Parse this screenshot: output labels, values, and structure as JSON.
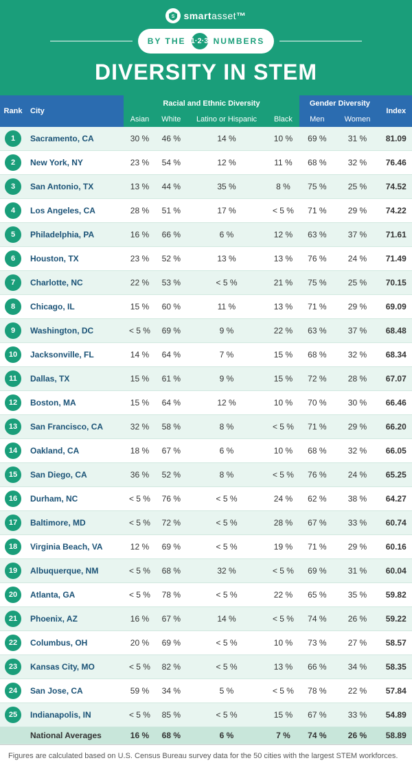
{
  "header": {
    "logo": "smartasset",
    "logo_icon": "shield",
    "badge_text": "BY THE",
    "badge_numbers": "1·2·3",
    "badge_suffix": "NUMBERS",
    "title": "DIVERSITY IN STEM"
  },
  "table": {
    "col_group1": "Racial and Ethnic Diversity",
    "col_group2": "Gender Diversity",
    "col_index": "Index",
    "col_rank": "Rank",
    "col_city": "City",
    "subheaders": [
      "Asian",
      "White",
      "Latino or Hispanic",
      "Black",
      "Men",
      "Women"
    ],
    "rows": [
      {
        "rank": 1,
        "city": "Sacramento, CA",
        "asian": "30 %",
        "white": "46 %",
        "latino": "14 %",
        "black": "10 %",
        "men": "69 %",
        "women": "31 %",
        "index": "81.09"
      },
      {
        "rank": 2,
        "city": "New York, NY",
        "asian": "23 %",
        "white": "54 %",
        "latino": "12 %",
        "black": "11 %",
        "men": "68 %",
        "women": "32 %",
        "index": "76.46"
      },
      {
        "rank": 3,
        "city": "San Antonio, TX",
        "asian": "13 %",
        "white": "44 %",
        "latino": "35 %",
        "black": "8 %",
        "men": "75 %",
        "women": "25 %",
        "index": "74.52"
      },
      {
        "rank": 4,
        "city": "Los Angeles, CA",
        "asian": "28 %",
        "white": "51 %",
        "latino": "17 %",
        "black": "< 5 %",
        "men": "71 %",
        "women": "29 %",
        "index": "74.22"
      },
      {
        "rank": 5,
        "city": "Philadelphia, PA",
        "asian": "16 %",
        "white": "66 %",
        "latino": "6 %",
        "black": "12 %",
        "men": "63 %",
        "women": "37 %",
        "index": "71.61"
      },
      {
        "rank": 6,
        "city": "Houston, TX",
        "asian": "23 %",
        "white": "52 %",
        "latino": "13 %",
        "black": "13 %",
        "men": "76 %",
        "women": "24 %",
        "index": "71.49"
      },
      {
        "rank": 7,
        "city": "Charlotte, NC",
        "asian": "22 %",
        "white": "53 %",
        "latino": "< 5 %",
        "black": "21 %",
        "men": "75 %",
        "women": "25 %",
        "index": "70.15"
      },
      {
        "rank": 8,
        "city": "Chicago, IL",
        "asian": "15 %",
        "white": "60 %",
        "latino": "11 %",
        "black": "13 %",
        "men": "71 %",
        "women": "29 %",
        "index": "69.09"
      },
      {
        "rank": 9,
        "city": "Washington, DC",
        "asian": "< 5 %",
        "white": "69 %",
        "latino": "9 %",
        "black": "22 %",
        "men": "63 %",
        "women": "37 %",
        "index": "68.48"
      },
      {
        "rank": 10,
        "city": "Jacksonville, FL",
        "asian": "14 %",
        "white": "64 %",
        "latino": "7 %",
        "black": "15 %",
        "men": "68 %",
        "women": "32 %",
        "index": "68.34"
      },
      {
        "rank": 11,
        "city": "Dallas, TX",
        "asian": "15 %",
        "white": "61 %",
        "latino": "9 %",
        "black": "15 %",
        "men": "72 %",
        "women": "28 %",
        "index": "67.07"
      },
      {
        "rank": 12,
        "city": "Boston, MA",
        "asian": "15 %",
        "white": "64 %",
        "latino": "12 %",
        "black": "10 %",
        "men": "70 %",
        "women": "30 %",
        "index": "66.46"
      },
      {
        "rank": 13,
        "city": "San Francisco, CA",
        "asian": "32 %",
        "white": "58 %",
        "latino": "8 %",
        "black": "< 5 %",
        "men": "71 %",
        "women": "29 %",
        "index": "66.20"
      },
      {
        "rank": 14,
        "city": "Oakland, CA",
        "asian": "18 %",
        "white": "67 %",
        "latino": "6 %",
        "black": "10 %",
        "men": "68 %",
        "women": "32 %",
        "index": "66.05"
      },
      {
        "rank": 15,
        "city": "San Diego, CA",
        "asian": "36 %",
        "white": "52 %",
        "latino": "8 %",
        "black": "< 5 %",
        "men": "76 %",
        "women": "24 %",
        "index": "65.25"
      },
      {
        "rank": 16,
        "city": "Durham, NC",
        "asian": "< 5 %",
        "white": "76 %",
        "latino": "< 5 %",
        "black": "24 %",
        "men": "62 %",
        "women": "38 %",
        "index": "64.27"
      },
      {
        "rank": 17,
        "city": "Baltimore, MD",
        "asian": "< 5 %",
        "white": "72 %",
        "latino": "< 5 %",
        "black": "28 %",
        "men": "67 %",
        "women": "33 %",
        "index": "60.74"
      },
      {
        "rank": 18,
        "city": "Virginia Beach, VA",
        "asian": "12 %",
        "white": "69 %",
        "latino": "< 5 %",
        "black": "19 %",
        "men": "71 %",
        "women": "29 %",
        "index": "60.16"
      },
      {
        "rank": 19,
        "city": "Albuquerque, NM",
        "asian": "< 5 %",
        "white": "68 %",
        "latino": "32 %",
        "black": "< 5 %",
        "men": "69 %",
        "women": "31 %",
        "index": "60.04"
      },
      {
        "rank": 20,
        "city": "Atlanta, GA",
        "asian": "< 5 %",
        "white": "78 %",
        "latino": "< 5 %",
        "black": "22 %",
        "men": "65 %",
        "women": "35 %",
        "index": "59.82"
      },
      {
        "rank": 21,
        "city": "Phoenix, AZ",
        "asian": "16 %",
        "white": "67 %",
        "latino": "14 %",
        "black": "< 5 %",
        "men": "74 %",
        "women": "26 %",
        "index": "59.22"
      },
      {
        "rank": 22,
        "city": "Columbus, OH",
        "asian": "20 %",
        "white": "69 %",
        "latino": "< 5 %",
        "black": "10 %",
        "men": "73 %",
        "women": "27 %",
        "index": "58.57"
      },
      {
        "rank": 23,
        "city": "Kansas City, MO",
        "asian": "< 5 %",
        "white": "82 %",
        "latino": "< 5 %",
        "black": "13 %",
        "men": "66 %",
        "women": "34 %",
        "index": "58.35"
      },
      {
        "rank": 24,
        "city": "San Jose, CA",
        "asian": "59 %",
        "white": "34 %",
        "latino": "5 %",
        "black": "< 5 %",
        "men": "78 %",
        "women": "22 %",
        "index": "57.84"
      },
      {
        "rank": 25,
        "city": "Indianapolis, IN",
        "asian": "< 5 %",
        "white": "85 %",
        "latino": "< 5 %",
        "black": "15 %",
        "men": "67 %",
        "women": "33 %",
        "index": "54.89"
      },
      {
        "rank": null,
        "city": "National Averages",
        "asian": "16 %",
        "white": "68 %",
        "latino": "6 %",
        "black": "7 %",
        "men": "74 %",
        "women": "26 %",
        "index": "58.89"
      }
    ]
  },
  "footer": "Figures are calculated based on U.S. Census Bureau survey data for the 50 cities with the largest STEM workforces."
}
